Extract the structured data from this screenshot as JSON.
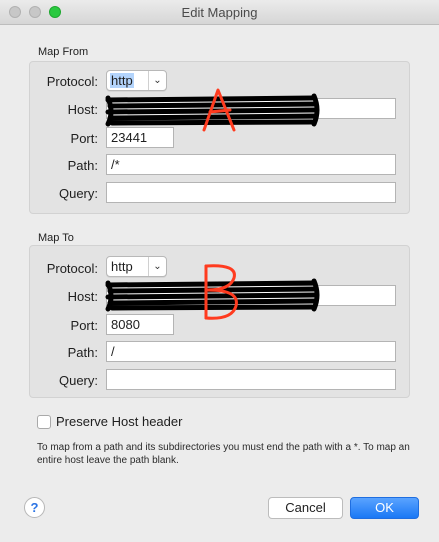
{
  "window": {
    "title": "Edit Mapping"
  },
  "map_from": {
    "title": "Map From",
    "protocol_label": "Protocol:",
    "protocol_value": "http",
    "host_label": "Host:",
    "host_value": "",
    "port_label": "Port:",
    "port_value": "23441",
    "path_label": "Path:",
    "path_value": "/*",
    "query_label": "Query:",
    "query_value": ""
  },
  "map_to": {
    "title": "Map To",
    "protocol_label": "Protocol:",
    "protocol_value": "http",
    "host_label": "Host:",
    "host_value": "",
    "port_label": "Port:",
    "port_value": "8080",
    "path_label": "Path:",
    "path_value": "/",
    "query_label": "Query:",
    "query_value": ""
  },
  "preserve_host": {
    "label": "Preserve Host header",
    "checked": false
  },
  "hint": "To map from a path and its subdirectories you must end the path with a *. To map an entire host leave the path blank.",
  "buttons": {
    "help": "?",
    "cancel": "Cancel",
    "ok": "OK"
  },
  "annotations": {
    "a": "A",
    "b": "B"
  },
  "colors": {
    "accent": "#1a78f5",
    "annotation": "#ff3b1f",
    "redaction": "#000000"
  }
}
